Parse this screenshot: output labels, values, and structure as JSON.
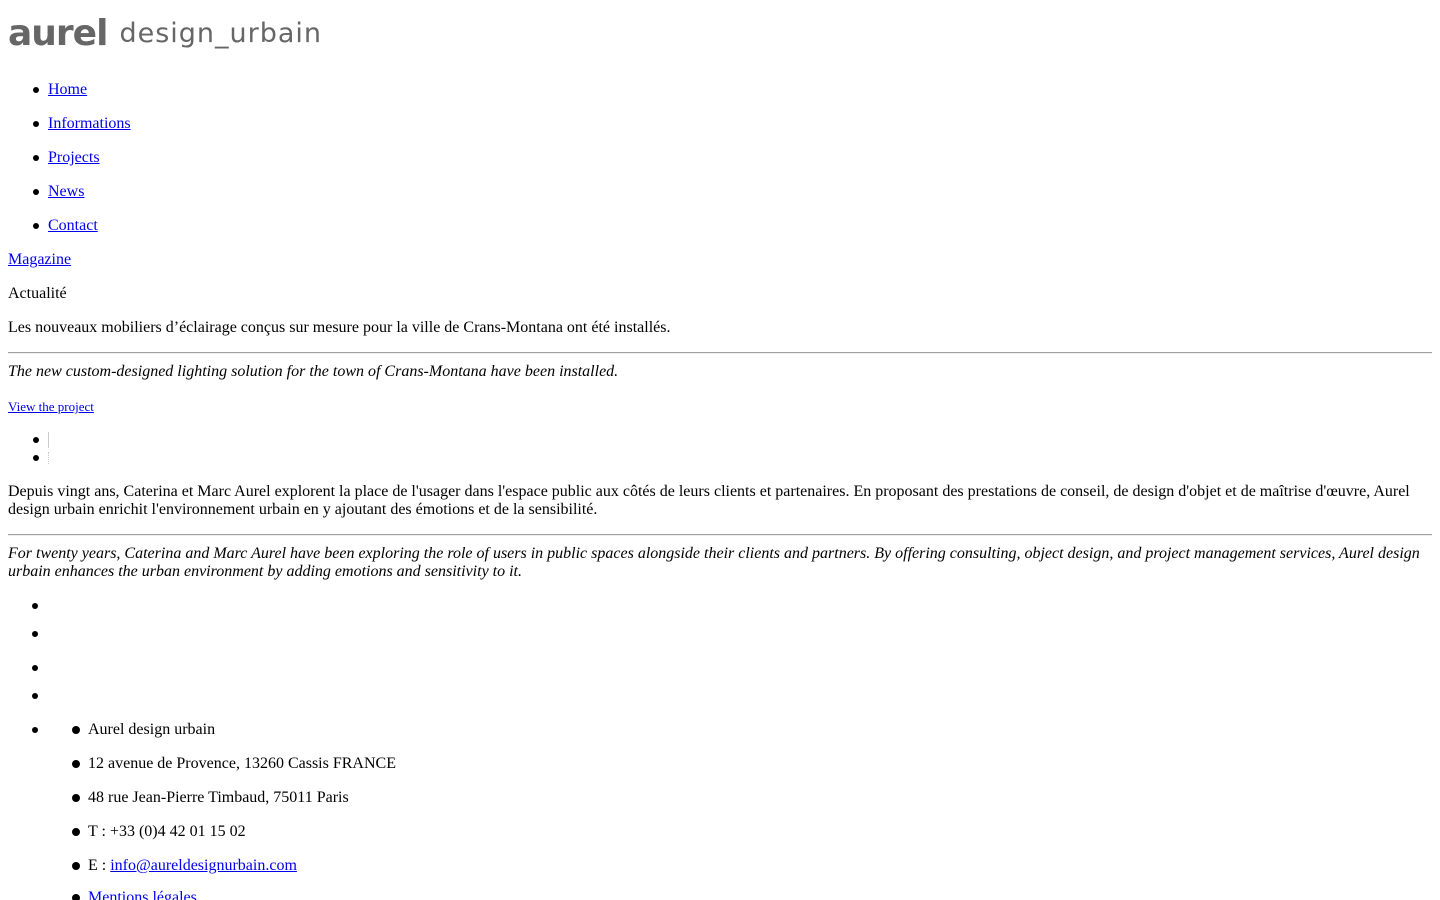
{
  "logo": {
    "mark": "aurel",
    "text": "design_urbain"
  },
  "nav": {
    "items": [
      {
        "label": "Home"
      },
      {
        "label": "Informations"
      },
      {
        "label": "Projects"
      },
      {
        "label": "News"
      },
      {
        "label": "Contact"
      }
    ]
  },
  "magazine_link": "Magazine",
  "news": {
    "category": "Actualité",
    "text_fr": "Les nouveaux mobiliers d’éclairage conçus sur mesure pour la ville de Crans-Montana ont été installés.",
    "text_en": "The new custom-designed lighting solution for the town of Crans-Montana have been installed.",
    "view_link": "View the project"
  },
  "about": {
    "text_fr": "Depuis vingt ans, Caterina et Marc Aurel explorent la place de l'usager dans l'espace public aux côtés de leurs clients et partenaires. En proposant des prestations de conseil, de design d'objet et de maîtrise d'œuvre, Aurel design urbain enrichit l'environnement urbain en y ajoutant des émotions et de la sensibilité.",
    "text_en": "For twenty years, Caterina and Marc Aurel have been exploring the role of users in public spaces alongside their clients and partners. By offering consulting, object design, and project management services, Aurel design urbain enhances the urban environment by adding emotions and sensitivity to it."
  },
  "footer": {
    "company": "Aurel design urbain",
    "address_1": "12 avenue de Provence, 13260 Cassis FRANCE",
    "address_2": "48 rue Jean-Pierre Timbaud, 75011 Paris",
    "phone": "T : +33 (0)4 42 01 15 02",
    "email_prefix": "E : ",
    "email": "info@aureldesignurbain.com",
    "legal_link": "Mentions légales"
  }
}
